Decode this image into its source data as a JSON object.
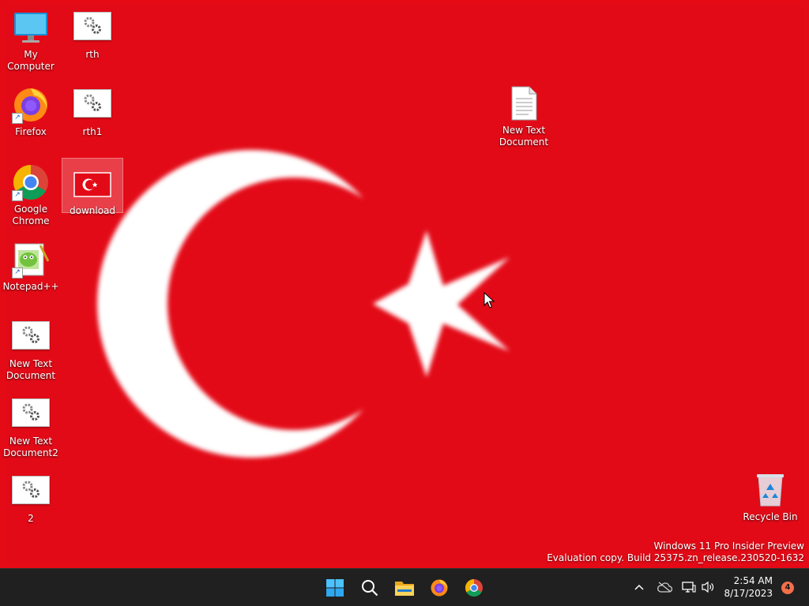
{
  "desktop": {
    "icons": [
      {
        "label": "My Computer"
      },
      {
        "label": "rth"
      },
      {
        "label": "Firefox"
      },
      {
        "label": "rth1"
      },
      {
        "label": "Google Chrome"
      },
      {
        "label": "download"
      },
      {
        "label": "Notepad++"
      },
      {
        "label": "New Text Document"
      },
      {
        "label": "New Text Document2"
      },
      {
        "label": "2"
      },
      {
        "label": "New Text Document"
      },
      {
        "label": "Recycle Bin"
      }
    ],
    "watermark": {
      "line1": "Windows 11 Pro Insider Preview",
      "line2": "Evaluation copy. Build 25375.zn_release.230520-1632"
    },
    "wallpaper_colors": {
      "red": "#e30a17",
      "white": "#ffffff"
    }
  },
  "taskbar": {
    "pinned": [
      "start-icon",
      "search-icon",
      "file-explorer-icon",
      "firefox-icon",
      "chrome-icon"
    ],
    "tray": [
      "chevron-up-icon",
      "onedrive-cloud-icon",
      "network-icon",
      "volume-icon"
    ],
    "clock": {
      "time": "2:54 AM",
      "date": "8/17/2023"
    },
    "notification_count": "4"
  }
}
